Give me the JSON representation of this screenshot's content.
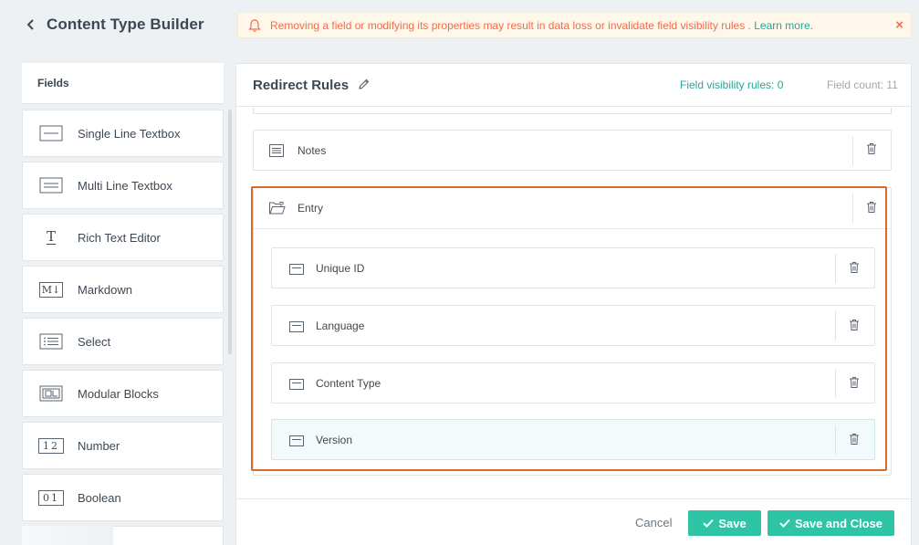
{
  "header": {
    "title": "Content Type Builder",
    "warning_text": "Removing a field or modifying its properties may result in data loss or invalidate field visibility rules .",
    "warning_link": "Learn more.",
    "close_glyph": "×"
  },
  "sidebar": {
    "heading": "Fields",
    "items": [
      {
        "label": "Single Line Textbox",
        "icon": "single-line-icon"
      },
      {
        "label": "Multi Line Textbox",
        "icon": "multi-line-icon"
      },
      {
        "label": "Rich Text Editor",
        "icon": "rich-text-icon",
        "glyph": "T"
      },
      {
        "label": "Markdown",
        "icon": "markdown-icon",
        "glyph": "M↓"
      },
      {
        "label": "Select",
        "icon": "select-list-icon"
      },
      {
        "label": "Modular Blocks",
        "icon": "modular-blocks-icon"
      },
      {
        "label": "Number",
        "icon": "number-icon",
        "glyph": "12"
      },
      {
        "label": "Boolean",
        "icon": "boolean-icon",
        "glyph": "01"
      }
    ]
  },
  "main": {
    "title": "Redirect Rules",
    "visibility_rules": "Field visibility rules: 0",
    "field_count": "Field count: 11",
    "fields": [
      {
        "label": "Notes",
        "icon": "notes-icon"
      },
      {
        "label": "Entry",
        "icon": "group-folder-icon"
      }
    ],
    "entry_children": [
      {
        "label": "Unique ID",
        "icon": "single-line-icon"
      },
      {
        "label": "Language",
        "icon": "single-line-icon"
      },
      {
        "label": "Content Type",
        "icon": "single-line-icon"
      },
      {
        "label": "Version",
        "icon": "single-line-icon",
        "highlighted": true
      }
    ]
  },
  "footer": {
    "cancel": "Cancel",
    "save": "Save",
    "save_close": "Save and Close"
  },
  "colors": {
    "accent": "#2ec4a5",
    "link": "#2aa49a",
    "warning": "#ef6d4c",
    "selection_outline": "#d9692a"
  }
}
